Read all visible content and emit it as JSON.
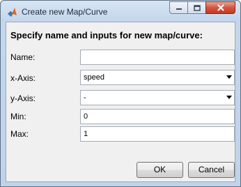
{
  "window": {
    "title": "Create new Map/Curve"
  },
  "dialog": {
    "heading": "Specify name and inputs for new map/curve:",
    "name": {
      "label": "Name:",
      "value": ""
    },
    "xaxis": {
      "label": "x-Axis:",
      "value": "speed"
    },
    "yaxis": {
      "label": "y-Axis:",
      "value": "-"
    },
    "min": {
      "label": "Min:",
      "value": "0"
    },
    "max": {
      "label": "Max:",
      "value": "1"
    }
  },
  "buttons": {
    "ok": "OK",
    "cancel": "Cancel"
  },
  "icons": {
    "app": "matlab-icon",
    "minimize": "minimize-icon",
    "maximize": "maximize-icon",
    "close": "close-icon",
    "dropdown": "chevron-down-icon"
  },
  "colors": {
    "close_button": "#c94a33",
    "client_background": "#f0f0f0"
  }
}
